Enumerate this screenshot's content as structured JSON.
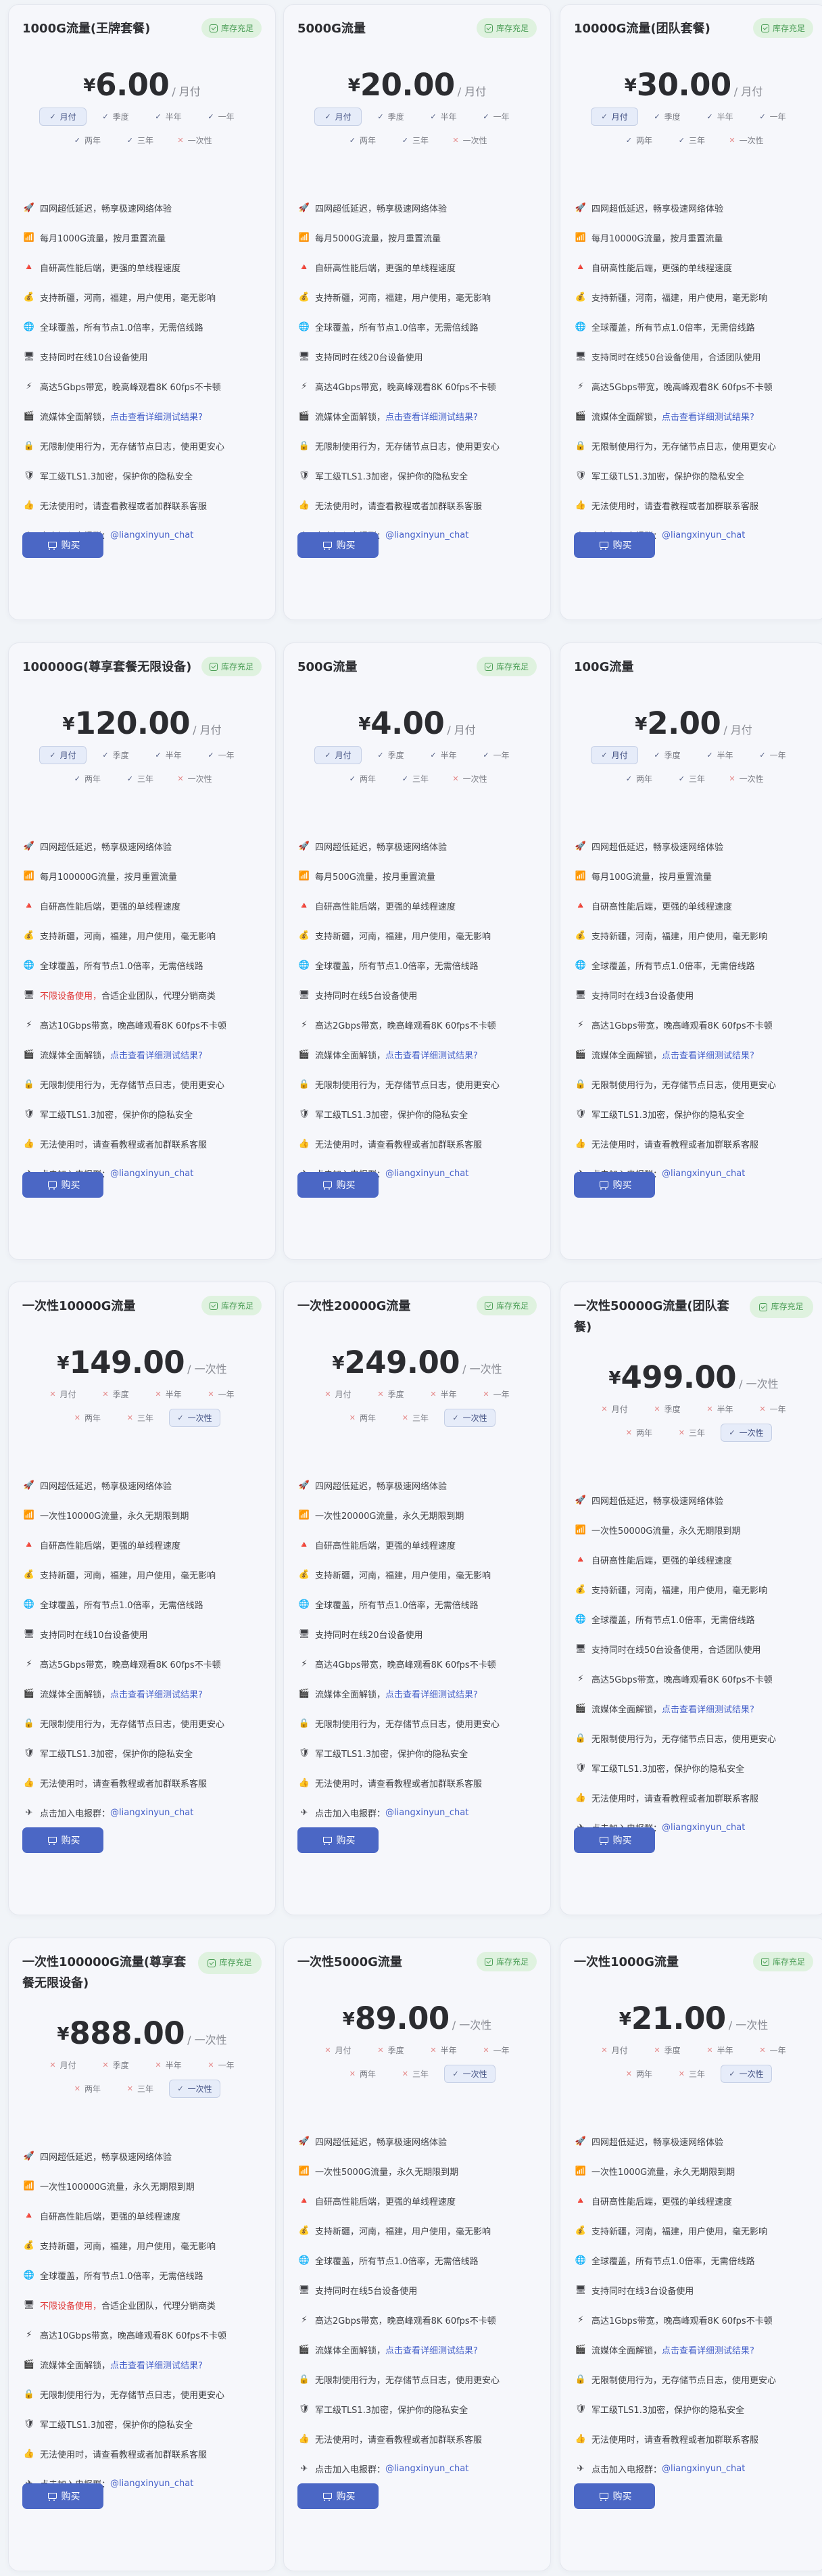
{
  "icons": {
    "rocket": "🚀",
    "speed": "📶",
    "tune": "🔺",
    "trust": "💰",
    "globe": "🌐",
    "device": "🖥",
    "bolt": "⚡",
    "media": "🎬",
    "noaudit": "🔒",
    "shield": "🛡",
    "thumbs": "👍",
    "telegram": "✈"
  },
  "colors": {
    "accent": "#4b67c5",
    "badge_bg": "#dff2df",
    "badge_fg": "#4a9d55",
    "warn": "#e03a3a",
    "link": "#4560c9"
  },
  "labels": {
    "buy": "购买"
  },
  "period_names": {
    "month": "月付",
    "quarter": "季度",
    "half": "半年",
    "year": "一年",
    "two_year": "两年",
    "three_year": "三年",
    "onetime": "一次性"
  },
  "cards": [
    {
      "title": "1000G流量(王牌套餐)",
      "badge": "库存充足",
      "currency": "¥",
      "amount": "6.00",
      "unit": "/ 月付",
      "selected": "month",
      "onetime_only": false,
      "feats": [
        {
          "i": "rocket",
          "t": "四网超低延迟，畅享极速网络体验"
        },
        {
          "i": "speed",
          "t": "每月1000G流量，按月重置流量"
        },
        {
          "i": "tune",
          "t": "自研高性能后端，更强的单线程速度"
        },
        {
          "i": "trust",
          "t": "支持新疆，河南，福建，用户使用，毫无影响"
        },
        {
          "i": "globe",
          "t": "全球覆盖，所有节点1.0倍率，无需倍线路"
        },
        {
          "i": "device",
          "t": "支持同时在线10台设备使用"
        },
        {
          "i": "bolt",
          "t": "高达5Gbps带宽，晚高峰观看8K 60fps不卡顿"
        },
        {
          "i": "media",
          "t": "流媒体全面解锁，",
          "l": "点击查看详细测试结果?"
        },
        {
          "i": "noaudit",
          "t": "无限制使用行为，无存储节点日志，使用更安心"
        },
        {
          "i": "shield",
          "t": "军工级TLS1.3加密，保护你的隐私安全"
        },
        {
          "i": "thumbs",
          "t": "无法使用时，请查看教程或者加群联系客服"
        },
        {
          "i": "telegram",
          "t": "点击加入电报群：",
          "l": "@liangxinyun_chat"
        }
      ]
    },
    {
      "title": "5000G流量",
      "badge": "库存充足",
      "currency": "¥",
      "amount": "20.00",
      "unit": "/ 月付",
      "selected": "month",
      "onetime_only": false,
      "feats": [
        {
          "i": "rocket",
          "t": "四网超低延迟，畅享极速网络体验"
        },
        {
          "i": "speed",
          "t": "每月5000G流量，按月重置流量"
        },
        {
          "i": "tune",
          "t": "自研高性能后端，更强的单线程速度"
        },
        {
          "i": "trust",
          "t": "支持新疆，河南，福建，用户使用，毫无影响"
        },
        {
          "i": "globe",
          "t": "全球覆盖，所有节点1.0倍率，无需倍线路"
        },
        {
          "i": "device",
          "t": "支持同时在线20台设备使用"
        },
        {
          "i": "bolt",
          "t": "高达4Gbps带宽，晚高峰观看8K 60fps不卡顿"
        },
        {
          "i": "media",
          "t": "流媒体全面解锁，",
          "l": "点击查看详细测试结果?"
        },
        {
          "i": "noaudit",
          "t": "无限制使用行为，无存储节点日志，使用更安心"
        },
        {
          "i": "shield",
          "t": "军工级TLS1.3加密，保护你的隐私安全"
        },
        {
          "i": "thumbs",
          "t": "无法使用时，请查看教程或者加群联系客服"
        },
        {
          "i": "telegram",
          "t": "点击加入电报群：",
          "l": "@liangxinyun_chat"
        }
      ]
    },
    {
      "title": "10000G流量(团队套餐)",
      "badge": "库存充足",
      "currency": "¥",
      "amount": "30.00",
      "unit": "/ 月付",
      "selected": "month",
      "onetime_only": false,
      "feats": [
        {
          "i": "rocket",
          "t": "四网超低延迟，畅享极速网络体验"
        },
        {
          "i": "speed",
          "t": "每月10000G流量，按月重置流量"
        },
        {
          "i": "tune",
          "t": "自研高性能后端，更强的单线程速度"
        },
        {
          "i": "trust",
          "t": "支持新疆，河南，福建，用户使用，毫无影响"
        },
        {
          "i": "globe",
          "t": "全球覆盖，所有节点1.0倍率，无需倍线路"
        },
        {
          "i": "device",
          "t": "支持同时在线50台设备使用，合适团队使用"
        },
        {
          "i": "bolt",
          "t": "高达5Gbps带宽，晚高峰观看8K 60fps不卡顿"
        },
        {
          "i": "media",
          "t": "流媒体全面解锁，",
          "l": "点击查看详细测试结果?"
        },
        {
          "i": "noaudit",
          "t": "无限制使用行为，无存储节点日志，使用更安心"
        },
        {
          "i": "shield",
          "t": "军工级TLS1.3加密，保护你的隐私安全"
        },
        {
          "i": "thumbs",
          "t": "无法使用时，请查看教程或者加群联系客服"
        },
        {
          "i": "telegram",
          "t": "点击加入电报群：",
          "l": "@liangxinyun_chat"
        }
      ]
    },
    {
      "title": "100000G(尊享套餐无限设备)",
      "badge": "库存充足",
      "currency": "¥",
      "amount": "120.00",
      "unit": "/ 月付",
      "selected": "month",
      "onetime_only": false,
      "feats": [
        {
          "i": "rocket",
          "t": "四网超低延迟，畅享极速网络体验"
        },
        {
          "i": "speed",
          "t": "每月100000G流量，按月重置流量"
        },
        {
          "i": "tune",
          "t": "自研高性能后端，更强的单线程速度"
        },
        {
          "i": "trust",
          "t": "支持新疆，河南，福建，用户使用，毫无影响"
        },
        {
          "i": "globe",
          "t": "全球覆盖，所有节点1.0倍率，无需倍线路"
        },
        {
          "i": "device",
          "r": "不限设备使用，",
          "t": "合适企业团队，代理分销商类"
        },
        {
          "i": "bolt",
          "t": "高达10Gbps带宽，晚高峰观看8K 60fps不卡顿"
        },
        {
          "i": "media",
          "t": "流媒体全面解锁，",
          "l": "点击查看详细测试结果?"
        },
        {
          "i": "noaudit",
          "t": "无限制使用行为，无存储节点日志，使用更安心"
        },
        {
          "i": "shield",
          "t": "军工级TLS1.3加密，保护你的隐私安全"
        },
        {
          "i": "thumbs",
          "t": "无法使用时，请查看教程或者加群联系客服"
        },
        {
          "i": "telegram",
          "t": "点击加入电报群：",
          "l": "@liangxinyun_chat"
        }
      ]
    },
    {
      "title": "500G流量",
      "badge": "库存充足",
      "currency": "¥",
      "amount": "4.00",
      "unit": "/ 月付",
      "selected": "month",
      "onetime_only": false,
      "feats": [
        {
          "i": "rocket",
          "t": "四网超低延迟，畅享极速网络体验"
        },
        {
          "i": "speed",
          "t": "每月500G流量，按月重置流量"
        },
        {
          "i": "tune",
          "t": "自研高性能后端，更强的单线程速度"
        },
        {
          "i": "trust",
          "t": "支持新疆，河南，福建，用户使用，毫无影响"
        },
        {
          "i": "globe",
          "t": "全球覆盖，所有节点1.0倍率，无需倍线路"
        },
        {
          "i": "device",
          "t": "支持同时在线5台设备使用"
        },
        {
          "i": "bolt",
          "t": "高达2Gbps带宽，晚高峰观看8K 60fps不卡顿"
        },
        {
          "i": "media",
          "t": "流媒体全面解锁，",
          "l": "点击查看详细测试结果?"
        },
        {
          "i": "noaudit",
          "t": "无限制使用行为，无存储节点日志，使用更安心"
        },
        {
          "i": "shield",
          "t": "军工级TLS1.3加密，保护你的隐私安全"
        },
        {
          "i": "thumbs",
          "t": "无法使用时，请查看教程或者加群联系客服"
        },
        {
          "i": "telegram",
          "t": "点击加入电报群：",
          "l": "@liangxinyun_chat"
        }
      ]
    },
    {
      "title": "100G流量",
      "badge": "",
      "currency": "¥",
      "amount": "2.00",
      "unit": "/ 月付",
      "selected": "month",
      "onetime_only": false,
      "feats": [
        {
          "i": "rocket",
          "t": "四网超低延迟，畅享极速网络体验"
        },
        {
          "i": "speed",
          "t": "每月100G流量，按月重置流量"
        },
        {
          "i": "tune",
          "t": "自研高性能后端，更强的单线程速度"
        },
        {
          "i": "trust",
          "t": "支持新疆，河南，福建，用户使用，毫无影响"
        },
        {
          "i": "globe",
          "t": "全球覆盖，所有节点1.0倍率，无需倍线路"
        },
        {
          "i": "device",
          "t": "支持同时在线3台设备使用"
        },
        {
          "i": "bolt",
          "t": "高达1Gbps带宽，晚高峰观看8K 60fps不卡顿"
        },
        {
          "i": "media",
          "t": "流媒体全面解锁，",
          "l": "点击查看详细测试结果?"
        },
        {
          "i": "noaudit",
          "t": "无限制使用行为，无存储节点日志，使用更安心"
        },
        {
          "i": "shield",
          "t": "军工级TLS1.3加密，保护你的隐私安全"
        },
        {
          "i": "thumbs",
          "t": "无法使用时，请查看教程或者加群联系客服"
        },
        {
          "i": "telegram",
          "t": "点击加入电报群：",
          "l": "@liangxinyun_chat"
        }
      ]
    },
    {
      "title": "一次性10000G流量",
      "badge": "库存充足",
      "currency": "¥",
      "amount": "149.00",
      "unit": "/ 一次性",
      "selected": "onetime",
      "onetime_only": true,
      "feats": [
        {
          "i": "rocket",
          "t": "四网超低延迟，畅享极速网络体验"
        },
        {
          "i": "speed",
          "t": "一次性10000G流量，永久无期限到期"
        },
        {
          "i": "tune",
          "t": "自研高性能后端，更强的单线程速度"
        },
        {
          "i": "trust",
          "t": "支持新疆，河南，福建，用户使用，毫无影响"
        },
        {
          "i": "globe",
          "t": "全球覆盖，所有节点1.0倍率，无需倍线路"
        },
        {
          "i": "device",
          "t": "支持同时在线10台设备使用"
        },
        {
          "i": "bolt",
          "t": "高达5Gbps带宽，晚高峰观看8K 60fps不卡顿"
        },
        {
          "i": "media",
          "t": "流媒体全面解锁，",
          "l": "点击查看详细测试结果?"
        },
        {
          "i": "noaudit",
          "t": "无限制使用行为，无存储节点日志，使用更安心"
        },
        {
          "i": "shield",
          "t": "军工级TLS1.3加密，保护你的隐私安全"
        },
        {
          "i": "thumbs",
          "t": "无法使用时，请查看教程或者加群联系客服"
        },
        {
          "i": "telegram",
          "t": "点击加入电报群：",
          "l": "@liangxinyun_chat"
        }
      ]
    },
    {
      "title": "一次性20000G流量",
      "badge": "库存充足",
      "currency": "¥",
      "amount": "249.00",
      "unit": "/ 一次性",
      "selected": "onetime",
      "onetime_only": true,
      "feats": [
        {
          "i": "rocket",
          "t": "四网超低延迟，畅享极速网络体验"
        },
        {
          "i": "speed",
          "t": "一次性20000G流量，永久无期限到期"
        },
        {
          "i": "tune",
          "t": "自研高性能后端，更强的单线程速度"
        },
        {
          "i": "trust",
          "t": "支持新疆，河南，福建，用户使用，毫无影响"
        },
        {
          "i": "globe",
          "t": "全球覆盖，所有节点1.0倍率，无需倍线路"
        },
        {
          "i": "device",
          "t": "支持同时在线20台设备使用"
        },
        {
          "i": "bolt",
          "t": "高达4Gbps带宽，晚高峰观看8K 60fps不卡顿"
        },
        {
          "i": "media",
          "t": "流媒体全面解锁，",
          "l": "点击查看详细测试结果?"
        },
        {
          "i": "noaudit",
          "t": "无限制使用行为，无存储节点日志，使用更安心"
        },
        {
          "i": "shield",
          "t": "军工级TLS1.3加密，保护你的隐私安全"
        },
        {
          "i": "thumbs",
          "t": "无法使用时，请查看教程或者加群联系客服"
        },
        {
          "i": "telegram",
          "t": "点击加入电报群：",
          "l": "@liangxinyun_chat"
        }
      ]
    },
    {
      "title": "一次性50000G流量(团队套餐)",
      "badge": "库存充足",
      "badge_two": true,
      "currency": "¥",
      "amount": "499.00",
      "unit": "/ 一次性",
      "selected": "onetime",
      "onetime_only": true,
      "feats": [
        {
          "i": "rocket",
          "t": "四网超低延迟，畅享极速网络体验"
        },
        {
          "i": "speed",
          "t": "一次性50000G流量，永久无期限到期"
        },
        {
          "i": "tune",
          "t": "自研高性能后端，更强的单线程速度"
        },
        {
          "i": "trust",
          "t": "支持新疆，河南，福建，用户使用，毫无影响"
        },
        {
          "i": "globe",
          "t": "全球覆盖，所有节点1.0倍率，无需倍线路"
        },
        {
          "i": "device",
          "t": "支持同时在线50台设备使用，合适团队使用"
        },
        {
          "i": "bolt",
          "t": "高达5Gbps带宽，晚高峰观看8K 60fps不卡顿"
        },
        {
          "i": "media",
          "t": "流媒体全面解锁，",
          "l": "点击查看详细测试结果?"
        },
        {
          "i": "noaudit",
          "t": "无限制使用行为，无存储节点日志，使用更安心"
        },
        {
          "i": "shield",
          "t": "军工级TLS1.3加密，保护你的隐私安全"
        },
        {
          "i": "thumbs",
          "t": "无法使用时，请查看教程或者加群联系客服"
        },
        {
          "i": "telegram",
          "t": "点击加入电报群：",
          "l": "@liangxinyun_chat"
        }
      ]
    },
    {
      "title": "一次性100000G流量(尊享套餐无限设备)",
      "badge": "库存充足",
      "badge_two": true,
      "currency": "¥",
      "amount": "888.00",
      "unit": "/ 一次性",
      "selected": "onetime",
      "onetime_only": true,
      "feats": [
        {
          "i": "rocket",
          "t": "四网超低延迟，畅享极速网络体验"
        },
        {
          "i": "speed",
          "t": "一次性100000G流量，永久无期限到期"
        },
        {
          "i": "tune",
          "t": "自研高性能后端，更强的单线程速度"
        },
        {
          "i": "trust",
          "t": "支持新疆，河南，福建，用户使用，毫无影响"
        },
        {
          "i": "globe",
          "t": "全球覆盖，所有节点1.0倍率，无需倍线路"
        },
        {
          "i": "device",
          "r": "不限设备使用，",
          "t": "合适企业团队，代理分销商类"
        },
        {
          "i": "bolt",
          "t": "高达10Gbps带宽，晚高峰观看8K 60fps不卡顿"
        },
        {
          "i": "media",
          "t": "流媒体全面解锁，",
          "l": "点击查看详细测试结果?"
        },
        {
          "i": "noaudit",
          "t": "无限制使用行为，无存储节点日志，使用更安心"
        },
        {
          "i": "shield",
          "t": "军工级TLS1.3加密，保护你的隐私安全"
        },
        {
          "i": "thumbs",
          "t": "无法使用时，请查看教程或者加群联系客服"
        },
        {
          "i": "telegram",
          "t": "点击加入电报群：",
          "l": "@liangxinyun_chat"
        }
      ]
    },
    {
      "title": "一次性5000G流量",
      "badge": "库存充足",
      "currency": "¥",
      "amount": "89.00",
      "unit": "/ 一次性",
      "selected": "onetime",
      "onetime_only": true,
      "feats": [
        {
          "i": "rocket",
          "t": "四网超低延迟，畅享极速网络体验"
        },
        {
          "i": "speed",
          "t": "一次性5000G流量，永久无期限到期"
        },
        {
          "i": "tune",
          "t": "自研高性能后端，更强的单线程速度"
        },
        {
          "i": "trust",
          "t": "支持新疆，河南，福建，用户使用，毫无影响"
        },
        {
          "i": "globe",
          "t": "全球覆盖，所有节点1.0倍率，无需倍线路"
        },
        {
          "i": "device",
          "t": "支持同时在线5台设备使用"
        },
        {
          "i": "bolt",
          "t": "高达2Gbps带宽，晚高峰观看8K 60fps不卡顿"
        },
        {
          "i": "media",
          "t": "流媒体全面解锁，",
          "l": "点击查看详细测试结果?"
        },
        {
          "i": "noaudit",
          "t": "无限制使用行为，无存储节点日志，使用更安心"
        },
        {
          "i": "shield",
          "t": "军工级TLS1.3加密，保护你的隐私安全"
        },
        {
          "i": "thumbs",
          "t": "无法使用时，请查看教程或者加群联系客服"
        },
        {
          "i": "telegram",
          "t": "点击加入电报群：",
          "l": "@liangxinyun_chat"
        }
      ]
    },
    {
      "title": "一次性1000G流量",
      "badge": "库存充足",
      "currency": "¥",
      "amount": "21.00",
      "unit": "/ 一次性",
      "selected": "onetime",
      "onetime_only": true,
      "feats": [
        {
          "i": "rocket",
          "t": "四网超低延迟，畅享极速网络体验"
        },
        {
          "i": "speed",
          "t": "一次性1000G流量，永久无期限到期"
        },
        {
          "i": "tune",
          "t": "自研高性能后端，更强的单线程速度"
        },
        {
          "i": "trust",
          "t": "支持新疆，河南，福建，用户使用，毫无影响"
        },
        {
          "i": "globe",
          "t": "全球覆盖，所有节点1.0倍率，无需倍线路"
        },
        {
          "i": "device",
          "t": "支持同时在线3台设备使用"
        },
        {
          "i": "bolt",
          "t": "高达1Gbps带宽，晚高峰观看8K 60fps不卡顿"
        },
        {
          "i": "media",
          "t": "流媒体全面解锁，",
          "l": "点击查看详细测试结果?"
        },
        {
          "i": "noaudit",
          "t": "无限制使用行为，无存储节点日志，使用更安心"
        },
        {
          "i": "shield",
          "t": "军工级TLS1.3加密，保护你的隐私安全"
        },
        {
          "i": "thumbs",
          "t": "无法使用时，请查看教程或者加群联系客服"
        },
        {
          "i": "telegram",
          "t": "点击加入电报群：",
          "l": "@liangxinyun_chat"
        }
      ]
    }
  ]
}
